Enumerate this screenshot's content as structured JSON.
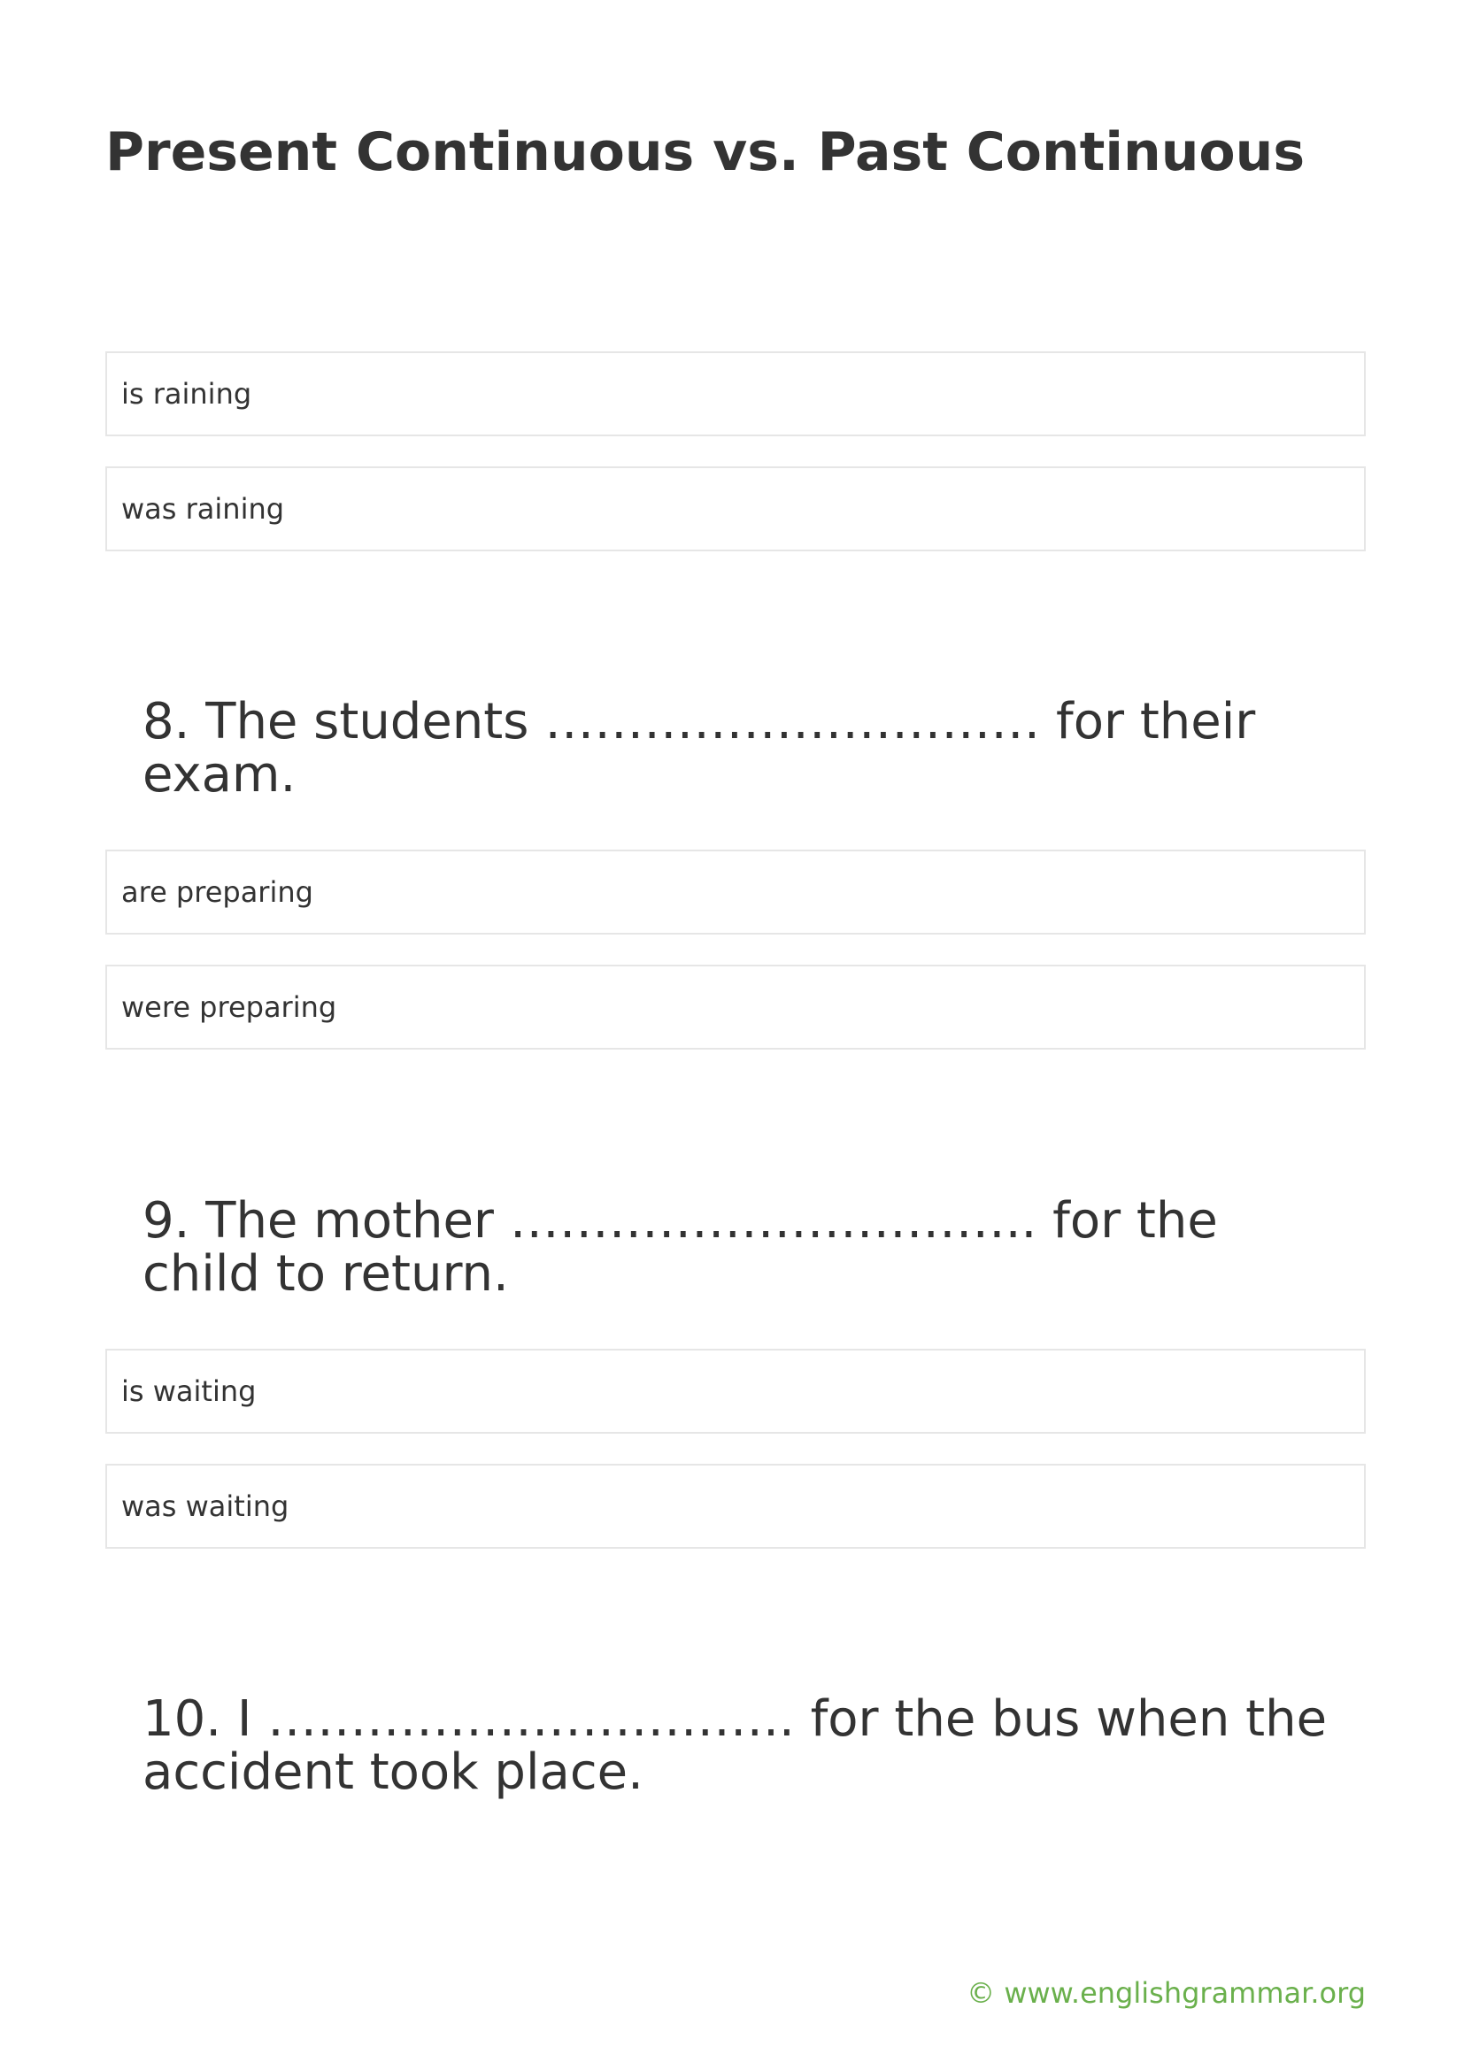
{
  "title": "Present Continuous vs. Past Continuous",
  "q7_options": [
    "is raining",
    "was raining"
  ],
  "q8": {
    "text": "8. The students ………………………… for their exam.",
    "options": [
      "are preparing",
      "were preparing"
    ]
  },
  "q9": {
    "text": "9. The mother ………………………….. for the child to return.",
    "options": [
      "is waiting",
      "was waiting"
    ]
  },
  "q10": {
    "text": "10. I ………………………….. for the bus when the accident took place."
  },
  "footer": "© www.englishgrammar.org",
  "colors": {
    "text": "#333333",
    "border": "#e6e6e6",
    "footer": "#6ab04c"
  }
}
